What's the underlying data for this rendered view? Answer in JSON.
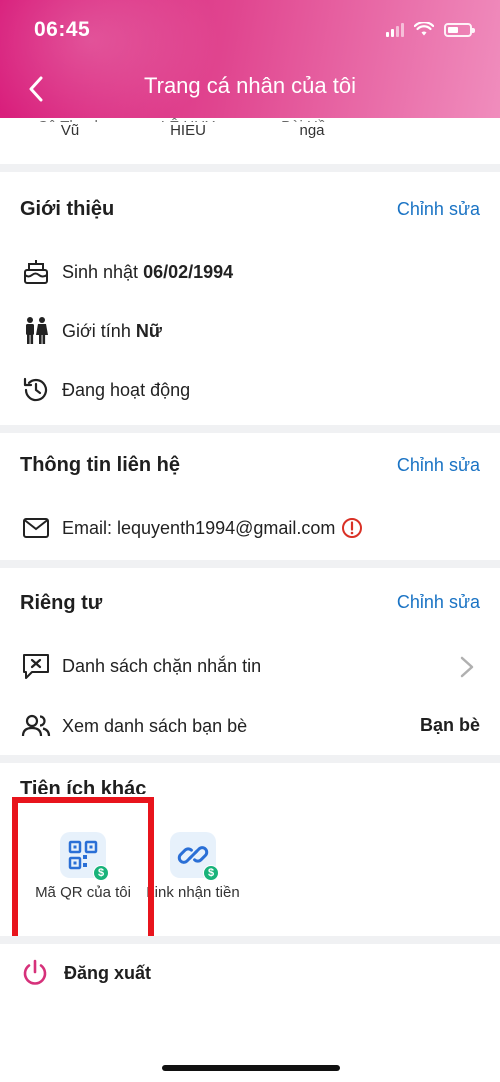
{
  "status_bar": {
    "time": "06:45"
  },
  "header": {
    "title": "Trang cá nhân của tôi"
  },
  "friends": [
    {
      "top": "Cô Thanh",
      "bottom": "Vũ"
    },
    {
      "top": "LÊ HUY",
      "bottom": "HIEU"
    },
    {
      "top": "Bùi Hồng",
      "bottom": "nga"
    }
  ],
  "intro": {
    "title": "Giới thiệu",
    "edit_label": "Chỉnh sửa",
    "birthday_label": "Sinh nhật",
    "birthday_value": "06/02/1994",
    "gender_label": "Giới tính",
    "gender_value": "Nữ",
    "activity_label": "Đang hoạt động"
  },
  "contact": {
    "title": "Thông tin liên hệ",
    "edit_label": "Chỉnh sửa",
    "email_text": "Email: lequyenth1994@gmail.com"
  },
  "privacy": {
    "title": "Riêng tư",
    "edit_label": "Chỉnh sửa",
    "block_list_label": "Danh sách chặn nhắn tin",
    "friend_list_label": "Xem danh sách bạn bè",
    "friend_list_value": "Bạn bè"
  },
  "utilities": {
    "title": "Tiện ích khác",
    "items": [
      {
        "label": "Mã QR của tôi",
        "icon": "qr-code-icon"
      },
      {
        "label": "Link nhận tiền",
        "icon": "link-icon"
      }
    ]
  },
  "logout": {
    "label": "Đăng xuất"
  },
  "colors": {
    "header_start": "#d81b7a",
    "accent_link": "#1a73c4",
    "highlight": "#e8141c",
    "logout_icon": "#d6317a",
    "warning": "#d93025"
  }
}
